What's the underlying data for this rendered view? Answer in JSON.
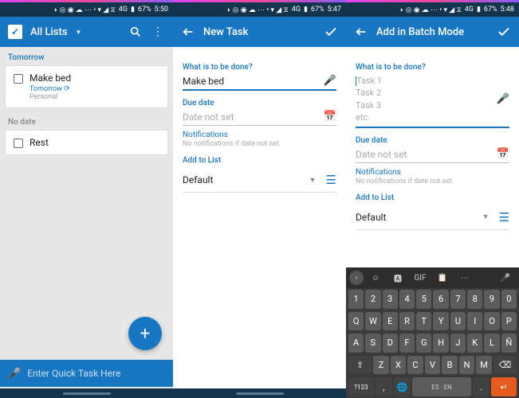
{
  "status": {
    "icons": "◗ ◎ ◉ ☁ ⋯  • ▾ ◢ ⧖",
    "battery": "67%",
    "time1": "5:50",
    "time2": "5:47",
    "time3": "5:48",
    "net": "4G"
  },
  "screen1": {
    "title": "All Lists",
    "section1": "Tomorrow",
    "task1": {
      "title": "Make bed",
      "sub": "Tomorrow ⟳",
      "sub2": "Personal"
    },
    "section2": "No date",
    "task2": {
      "title": "Rest"
    },
    "quick_placeholder": "Enter Quick Task Here"
  },
  "screen2": {
    "title": "New Task",
    "label1": "What is to be done?",
    "input1": "Make bed",
    "label2": "Due date",
    "input2": "Date not set",
    "link": "Notifications",
    "helper": "No notifications if date not set.",
    "label3": "Add to List",
    "list_value": "Default"
  },
  "screen3": {
    "title": "Add in Batch Mode",
    "label1": "What is to be done?",
    "placeholder_lines": "Task 1\nTask 2\nTask 3\netc.",
    "label2": "Due date",
    "input2": "Date not set",
    "link": "Notifications",
    "helper": "No notifications if date not set.",
    "label3": "Add to List",
    "list_value": "Default"
  },
  "keyboard": {
    "row_num": [
      "1",
      "2",
      "3",
      "4",
      "5",
      "6",
      "7",
      "8",
      "9",
      "0"
    ],
    "row1": [
      "Q",
      "W",
      "E",
      "R",
      "T",
      "Y",
      "U",
      "I",
      "O",
      "P"
    ],
    "row2": [
      "A",
      "S",
      "D",
      "F",
      "G",
      "H",
      "J",
      "K",
      "L",
      "Ñ"
    ],
    "row3": [
      "Z",
      "X",
      "C",
      "V",
      "B",
      "N",
      "M"
    ],
    "bottom": {
      "sym": "?123",
      "lang": "ES · EN"
    },
    "gif": "GIF"
  }
}
